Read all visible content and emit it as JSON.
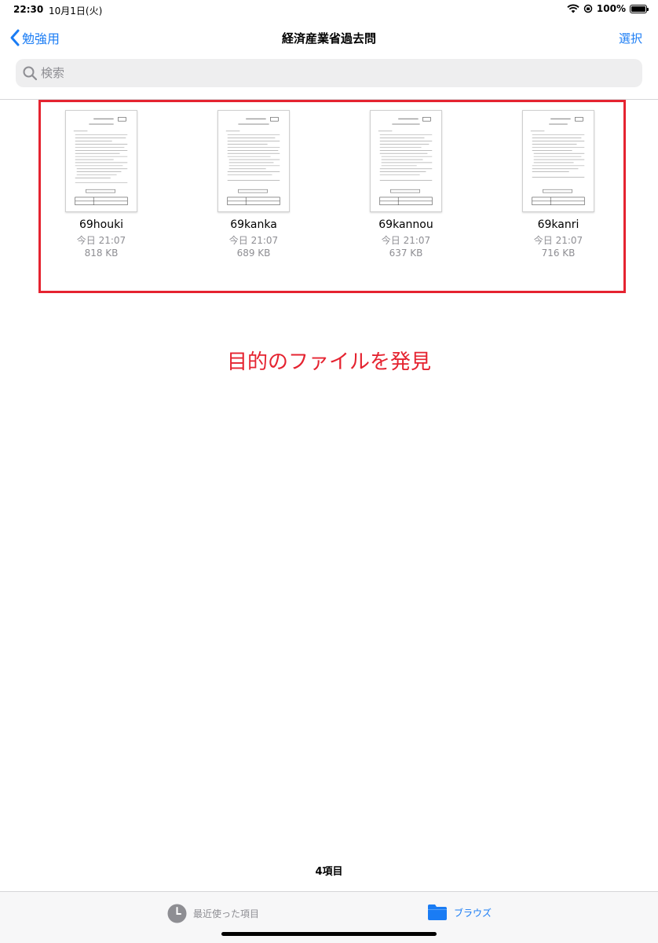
{
  "status_bar": {
    "time": "22:30",
    "date": "10月1日(火)",
    "battery": "100%"
  },
  "nav": {
    "back_label": "勉強用",
    "title": "経済産業省過去問",
    "select_label": "選択"
  },
  "search": {
    "placeholder": "検索"
  },
  "files": [
    {
      "name": "69houki",
      "date": "今日 21:07",
      "size": "818 KB"
    },
    {
      "name": "69kanka",
      "date": "今日 21:07",
      "size": "689 KB"
    },
    {
      "name": "69kannou",
      "date": "今日 21:07",
      "size": "637 KB"
    },
    {
      "name": "69kanri",
      "date": "今日 21:07",
      "size": "716 KB"
    }
  ],
  "annotation": "目的のファイルを発見",
  "item_count": "4項目",
  "tab_bar": {
    "recents_label": "最近使った項目",
    "browse_label": "ブラウズ"
  },
  "colors": {
    "accent": "#1a7cf4",
    "highlight": "#e52330",
    "secondary_text": "#8e8e93"
  }
}
